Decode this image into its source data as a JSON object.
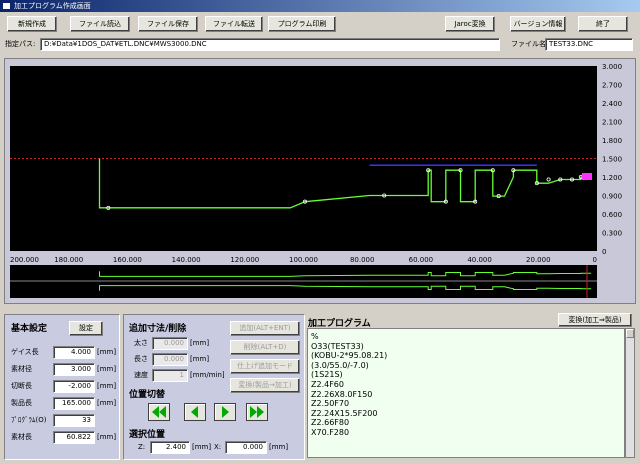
{
  "window": {
    "title": "加工プログラム作成画面"
  },
  "toolbar": {
    "new_label": "新規作成",
    "load_label": "ファイル読込",
    "save_label": "ファイル保存",
    "transfer_label": "ファイル転送",
    "print_label": "プログラム印刷",
    "jaroc_label": "Jaroc変換",
    "version_label": "バージョン情報",
    "exit_label": "終了"
  },
  "path": {
    "label": "指定パス:",
    "value": "D:¥Data¥1DOS_DAT¥ETL.DNC¥MWS3000.DNC",
    "filename_label": "ファイル名:",
    "filename_value": "TEST33.DNC"
  },
  "chart": {
    "x_ticks": [
      "200.000",
      "180.000",
      "160.000",
      "140.000",
      "120.000",
      "100.000",
      "80.000",
      "60.000",
      "40.000",
      "20.000",
      "0"
    ],
    "y_ticks": [
      "3.000",
      "2.700",
      "2.400",
      "2.100",
      "1.800",
      "1.500",
      "1.200",
      "0.900",
      "0.600",
      "0.300",
      "0"
    ]
  },
  "chart_data": {
    "type": "line",
    "x_reversed": true,
    "xlim": [
      200,
      0
    ],
    "ylim": [
      0,
      3
    ],
    "series": [
      {
        "x": [
          169.5,
          169.5,
          166.5,
          104.5,
          99.5,
          77.5,
          77.5,
          72.5,
          57.5,
          57.5,
          56.5,
          56.5,
          51.5,
          51.5,
          46.5,
          46.5,
          41.5,
          41.5,
          35.5,
          35.5,
          33.5,
          31.5,
          28.5,
          28.5,
          20.5,
          20.5,
          16.5,
          12.5,
          8.5,
          5.5,
          5.5,
          2.0
        ],
        "y": [
          1.5,
          0.7,
          0.7,
          0.7,
          0.8,
          0.9,
          0.9,
          0.9,
          0.9,
          1.31,
          1.31,
          0.8,
          0.8,
          1.31,
          1.31,
          0.8,
          0.8,
          1.31,
          1.31,
          0.89,
          0.89,
          0.89,
          1.2,
          1.31,
          1.31,
          1.1,
          1.1,
          1.16,
          1.16,
          1.16,
          1.2,
          1.2
        ]
      }
    ],
    "reference_line_y": 1.5,
    "markers_x": [
      166.5,
      99.5,
      72.5,
      57.5,
      51.5,
      46.5,
      41.5,
      35.5,
      33.5,
      28.5,
      20.5,
      16.5,
      12.5,
      8.5,
      5.5
    ],
    "markers_y": [
      0.7,
      0.8,
      0.9,
      1.31,
      0.8,
      1.31,
      0.8,
      1.31,
      0.89,
      1.31,
      1.1,
      1.16,
      1.16,
      1.16,
      1.2
    ],
    "blue_segment_x": [
      77.5,
      20.5
    ],
    "blue_segment_y": 1.39,
    "colors": {
      "background": "#000000",
      "profile": "#66ff33",
      "reference": "#cc2222",
      "blue": "#3333ff",
      "marker": "#ff33ff",
      "axis_text": "#dddddd"
    }
  },
  "basic": {
    "title": "基本設定",
    "set_button": "設定",
    "rows": [
      {
        "label": "ゲイス長",
        "value": "4.000",
        "unit": "[mm]"
      },
      {
        "label": "素材径",
        "value": "3.000",
        "unit": "[mm]"
      },
      {
        "label": "切断長",
        "value": "-2.000",
        "unit": "[mm]"
      },
      {
        "label": "製品長",
        "value": "165.000",
        "unit": "[mm]"
      },
      {
        "label": "ﾌﾟﾛｸﾞﾗﾑ(O)",
        "value": "33",
        "unit": ""
      },
      {
        "label": "素材長",
        "value": "60.822",
        "unit": "[mm]"
      }
    ]
  },
  "add": {
    "title": "追加寸法/削除",
    "rows": [
      {
        "label": "太さ",
        "value": "0.000",
        "unit": "[mm]"
      },
      {
        "label": "長さ",
        "value": "0.000",
        "unit": "[mm]"
      },
      {
        "label": "速度",
        "value": "1",
        "unit": "[mm/min]"
      }
    ],
    "add_button": "追加(ALT+ENT)",
    "delete_button": "削除(ALT+D)",
    "finish_button": "仕上げ追加モード",
    "convert_button": "変換(製品→加工)",
    "switch_title": "位置切替",
    "select_title": "選択位置",
    "z_label": "Z:",
    "z_value": "2.400",
    "z_unit": "[mm]",
    "x_label": "X:",
    "x_value": "0.000",
    "x_unit": "[mm]"
  },
  "program": {
    "title": "加工プログラム",
    "convert_button": "変換(加工⇒製品)",
    "lines": [
      "%",
      "O33(TEST33)",
      "(KOBU-2*95.08.21)",
      "(3.0/55.0/-7.0)",
      "(1S21S)",
      "",
      "Z2.4F60",
      "Z2.26X8.0F150",
      "Z2.50F70",
      "Z2.24X15.5F200",
      "Z2.66F80",
      "X70.F280"
    ]
  }
}
